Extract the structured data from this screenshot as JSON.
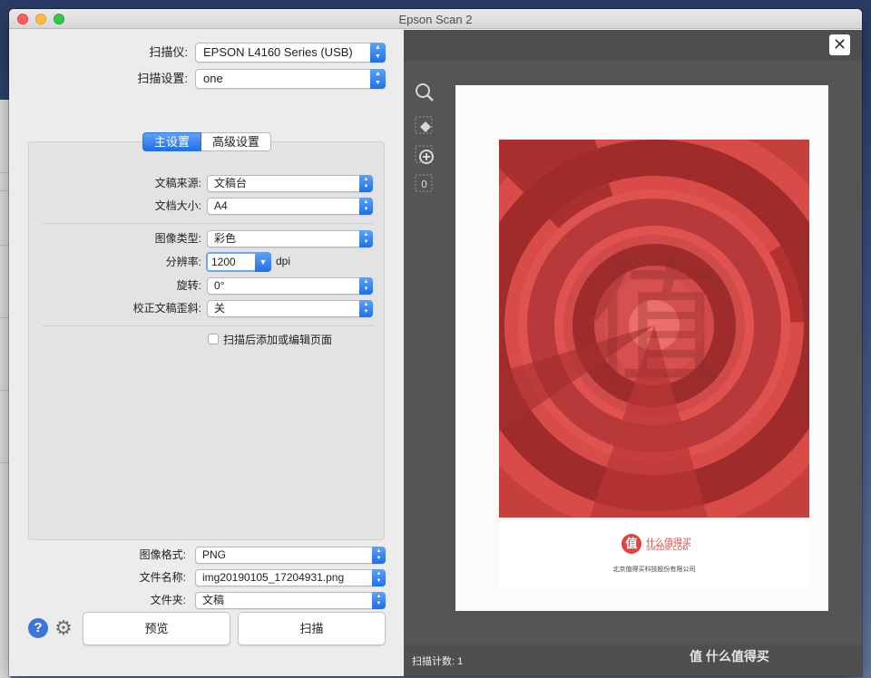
{
  "window": {
    "title": "Epson Scan 2"
  },
  "scanner": {
    "label": "扫描仪:",
    "value": "EPSON L4160 Series (USB)"
  },
  "scan_settings": {
    "label": "扫描设置:",
    "value": "one"
  },
  "tabs": [
    {
      "label": "主设置",
      "active": true
    },
    {
      "label": "高级设置",
      "active": false
    }
  ],
  "main_settings": {
    "source": {
      "label": "文稿来源:",
      "value": "文稿台"
    },
    "size": {
      "label": "文档大小:",
      "value": "A4"
    },
    "image_type": {
      "label": "图像类型:",
      "value": "彩色"
    },
    "resolution": {
      "label": "分辨率:",
      "value": "1200",
      "unit": "dpi"
    },
    "rotate": {
      "label": "旋转:",
      "value": "0°"
    },
    "deskew": {
      "label": "校正文稿歪斜:",
      "value": "关"
    },
    "add_edit": {
      "label": "扫描后添加或编辑页面",
      "checked": false
    }
  },
  "output": {
    "format": {
      "label": "图像格式:",
      "value": "PNG"
    },
    "filename": {
      "label": "文件名称:",
      "value": "img20190105_17204931.png"
    },
    "folder": {
      "label": "文件夹:",
      "value": "文稿"
    }
  },
  "buttons": {
    "preview": "预览",
    "scan": "扫描",
    "help": "?"
  },
  "preview": {
    "brand_cn": "什么值得买",
    "brand_en": "SMZDM.COM",
    "logo_char": "值",
    "company": "北京值得买科技股份有限公司",
    "stamp_char": "值",
    "scan_count": "扫描计数: 1",
    "watermark": "值 什么值得买"
  },
  "icons": {
    "zoom": "magnifier-icon",
    "erase": "eraser-icon",
    "add": "add-page-icon",
    "count": "page-count-icon",
    "settings": "gear-icon",
    "close": "close-icon"
  },
  "colors": {
    "accent": "#2a74e2",
    "cover_red": "#c7403e",
    "preview_bg": "#555555"
  },
  "tool_count_badge": "0"
}
